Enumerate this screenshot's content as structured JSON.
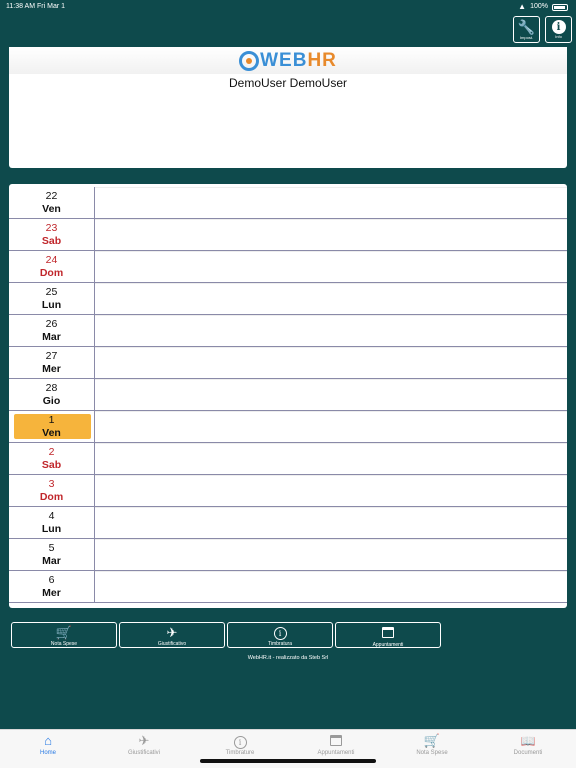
{
  "status_bar": {
    "time": "11:38 AM  Fri Mar 1",
    "battery": "100%"
  },
  "header": {
    "settings_label": "Impost.",
    "info_label": "Info",
    "logo_web": "WEB",
    "logo_hr": "HR",
    "user_name": "DemoUser DemoUser"
  },
  "calendar": {
    "rows": [
      {
        "num": "22",
        "name": "Ven",
        "weekend": false,
        "today": false
      },
      {
        "num": "23",
        "name": "Sab",
        "weekend": true,
        "today": false
      },
      {
        "num": "24",
        "name": "Dom",
        "weekend": true,
        "today": false
      },
      {
        "num": "25",
        "name": "Lun",
        "weekend": false,
        "today": false
      },
      {
        "num": "26",
        "name": "Mar",
        "weekend": false,
        "today": false
      },
      {
        "num": "27",
        "name": "Mer",
        "weekend": false,
        "today": false
      },
      {
        "num": "28",
        "name": "Gio",
        "weekend": false,
        "today": false
      },
      {
        "num": "1",
        "name": "Ven",
        "weekend": false,
        "today": true
      },
      {
        "num": "2",
        "name": "Sab",
        "weekend": true,
        "today": false
      },
      {
        "num": "3",
        "name": "Dom",
        "weekend": true,
        "today": false
      },
      {
        "num": "4",
        "name": "Lun",
        "weekend": false,
        "today": false
      },
      {
        "num": "5",
        "name": "Mar",
        "weekend": false,
        "today": false
      },
      {
        "num": "6",
        "name": "Mer",
        "weekend": false,
        "today": false
      }
    ]
  },
  "actions": [
    {
      "label": "Nota Spese",
      "icon": "cart-icon"
    },
    {
      "label": "Giustificativo",
      "icon": "airplane-icon"
    },
    {
      "label": "Timbratura",
      "icon": "clock-info-icon"
    },
    {
      "label": "Appuntamenti",
      "icon": "calendar-icon"
    }
  ],
  "footer_note": "WebHR.it - realizzato da Steb Srl",
  "tabs": [
    {
      "label": "Home",
      "icon": "home-icon",
      "active": true
    },
    {
      "label": "Giustificativi",
      "icon": "airplane-icon",
      "active": false
    },
    {
      "label": "Timbrature",
      "icon": "clock-info-icon",
      "active": false
    },
    {
      "label": "Appuntamenti",
      "icon": "calendar-icon",
      "active": false
    },
    {
      "label": "Nota Spese",
      "icon": "cart-icon",
      "active": false
    },
    {
      "label": "Documenti",
      "icon": "book-icon",
      "active": false
    }
  ],
  "colors": {
    "background": "#0e4a4c",
    "weekend_text": "#c0262b",
    "today_highlight": "#f6b43c",
    "active_tab": "#2a7be4"
  }
}
